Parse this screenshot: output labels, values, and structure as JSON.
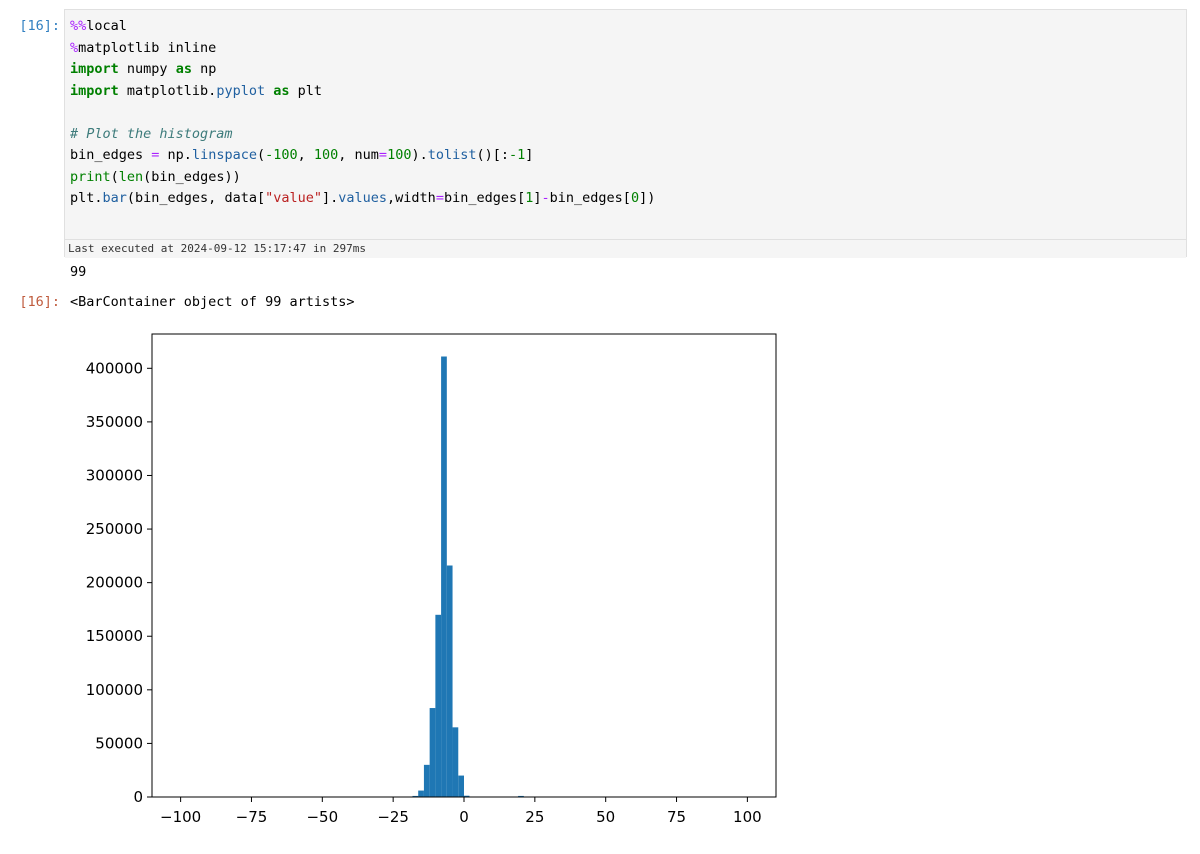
{
  "cell": {
    "input_prompt": "[16]:",
    "output_prompt": "[16]:",
    "exec_status": "Last executed at 2024-09-12 15:17:47 in 297ms",
    "stdout": "99",
    "result_repr": "<BarContainer object of 99 artists>",
    "code_lines": [
      [
        {
          "t": "%%",
          "c": "mag"
        },
        {
          "t": "local",
          "c": ""
        }
      ],
      [
        {
          "t": "%",
          "c": "mag"
        },
        {
          "t": "matplotlib inline",
          "c": ""
        }
      ],
      [
        {
          "t": "import",
          "c": "kw"
        },
        {
          "t": " numpy ",
          "c": ""
        },
        {
          "t": "as",
          "c": "kw"
        },
        {
          "t": " np",
          "c": ""
        }
      ],
      [
        {
          "t": "import",
          "c": "kw"
        },
        {
          "t": " matplotlib.",
          "c": ""
        },
        {
          "t": "pyplot",
          "c": "attr"
        },
        {
          "t": " ",
          "c": ""
        },
        {
          "t": "as",
          "c": "kw"
        },
        {
          "t": " plt",
          "c": ""
        }
      ],
      [],
      [
        {
          "t": "# Plot the histogram",
          "c": "cmt"
        }
      ],
      [
        {
          "t": "bin_edges ",
          "c": ""
        },
        {
          "t": "=",
          "c": "op"
        },
        {
          "t": " np.",
          "c": ""
        },
        {
          "t": "linspace",
          "c": "attr"
        },
        {
          "t": "(",
          "c": ""
        },
        {
          "t": "-100",
          "c": "num"
        },
        {
          "t": ", ",
          "c": ""
        },
        {
          "t": "100",
          "c": "num"
        },
        {
          "t": ", num",
          "c": ""
        },
        {
          "t": "=",
          "c": "op"
        },
        {
          "t": "100",
          "c": "num"
        },
        {
          "t": ").",
          "c": ""
        },
        {
          "t": "tolist",
          "c": "attr"
        },
        {
          "t": "()[:",
          "c": ""
        },
        {
          "t": "-1",
          "c": "num"
        },
        {
          "t": "]",
          "c": ""
        }
      ],
      [
        {
          "t": "print",
          "c": "bi"
        },
        {
          "t": "(",
          "c": ""
        },
        {
          "t": "len",
          "c": "bi"
        },
        {
          "t": "(bin_edges))",
          "c": ""
        }
      ],
      [
        {
          "t": "plt.",
          "c": ""
        },
        {
          "t": "bar",
          "c": "attr"
        },
        {
          "t": "(bin_edges, data[",
          "c": ""
        },
        {
          "t": "\"value\"",
          "c": "str"
        },
        {
          "t": "].",
          "c": ""
        },
        {
          "t": "values",
          "c": "attr"
        },
        {
          "t": ",width",
          "c": ""
        },
        {
          "t": "=",
          "c": "op"
        },
        {
          "t": "bin_edges[",
          "c": ""
        },
        {
          "t": "1",
          "c": "num"
        },
        {
          "t": "]",
          "c": ""
        },
        {
          "t": "-",
          "c": "op"
        },
        {
          "t": "bin_edges[",
          "c": ""
        },
        {
          "t": "0",
          "c": "num"
        },
        {
          "t": "])",
          "c": ""
        }
      ]
    ]
  },
  "chart_data": {
    "type": "bar",
    "bar_color": "#1f77b4",
    "xlim": [
      -110.1,
      110.1
    ],
    "ylim": [
      0,
      432000
    ],
    "xticks": [
      -100,
      -75,
      -50,
      -25,
      0,
      25,
      50,
      75,
      100
    ],
    "xtick_labels": [
      "−100",
      "−75",
      "−50",
      "−25",
      "0",
      "25",
      "50",
      "75",
      "100"
    ],
    "yticks": [
      0,
      50000,
      100000,
      150000,
      200000,
      250000,
      300000,
      350000,
      400000
    ],
    "ytick_labels": [
      "0",
      "50000",
      "100000",
      "150000",
      "200000",
      "250000",
      "300000",
      "350000",
      "400000"
    ],
    "bar_width": 2.0202,
    "x": [
      -17.1717,
      -15.1515,
      -13.1313,
      -11.1111,
      -9.0909,
      -7.0707,
      -5.0505,
      -3.0303,
      -1.0101,
      0.9091,
      20.101
    ],
    "values": [
      1000,
      6000,
      30000,
      83000,
      170000,
      411000,
      216000,
      65000,
      20000,
      1200,
      1000
    ]
  }
}
